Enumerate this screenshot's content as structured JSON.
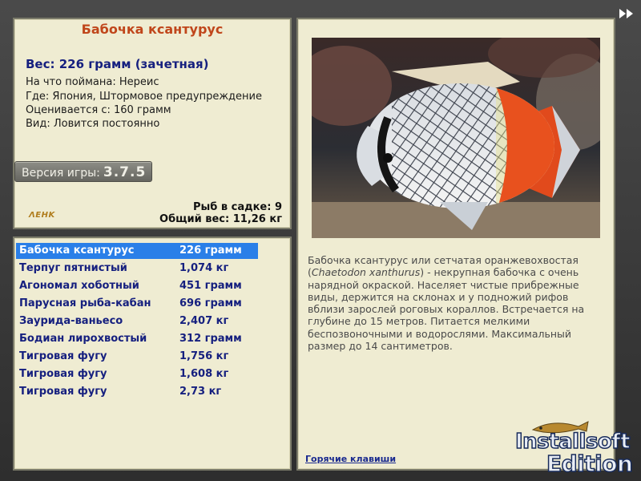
{
  "info": {
    "title": "Бабочка ксантурус",
    "weight": "Вес: 226 грамм (зачетная)",
    "caught_on": "На что поймана: Нереис",
    "location": "Где: Япония, Штормовое предупреждение",
    "valued_from": "Оценивается с: 160 грамм",
    "type": "Вид: Ловится постоянно"
  },
  "version": {
    "label": "Версия игры:",
    "number": "3.7.5"
  },
  "stats": {
    "in_cage": "Рыб в садке: 9",
    "total_weight": "Общий вес: 11,26 кг"
  },
  "small_logo": "ΛΕΗΚ",
  "catch_list": [
    {
      "name": "Бабочка ксантурус",
      "weight": "226 грамм",
      "selected": true
    },
    {
      "name": "Терпуг пятнистый",
      "weight": "1,074 кг",
      "selected": false
    },
    {
      "name": "Агономал хоботный",
      "weight": "451 грамм",
      "selected": false
    },
    {
      "name": "Парусная рыба-кабан",
      "weight": "696 грамм",
      "selected": false
    },
    {
      "name": "Заурида-ваньесо",
      "weight": "2,407 кг",
      "selected": false
    },
    {
      "name": "Бодиан лирохвостый",
      "weight": "312 грамм",
      "selected": false
    },
    {
      "name": "Тигровая фугу",
      "weight": "1,756 кг",
      "selected": false
    },
    {
      "name": "Тигровая фугу",
      "weight": "1,608 кг",
      "selected": false
    },
    {
      "name": "Тигровая фугу",
      "weight": "2,73 кг",
      "selected": false
    }
  ],
  "description": {
    "part1": "Бабочка ксантурус или сетчатая оранжевохвостая (",
    "latin": "Chaetodon xanthurus",
    "part2": ") - некрупная бабочка с очень нарядной окраской. Населяет чистые прибрежные виды, держится на склонах и у подножий рифов вблизи зарослей роговых кораллов. Встречается на глубине до 15 метров. Питается мелкими беспозвоночными и водорослями. Максимальный размер до  14 сантиметров."
  },
  "hotkeys_label": "Горячие клавиши",
  "watermark": {
    "line1": "Installsoft",
    "line2": "Edition"
  },
  "colors": {
    "panel_bg": "#efecd2",
    "selected_row": "#2a7fe8",
    "title": "#c0461b",
    "list_text": "#16207f"
  }
}
